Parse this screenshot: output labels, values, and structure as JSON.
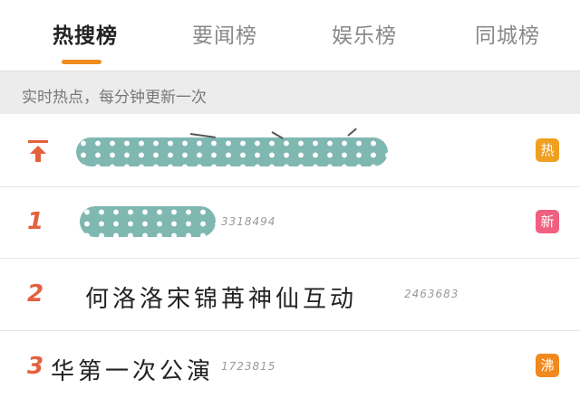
{
  "tabs": [
    {
      "label": "热搜榜",
      "active": true
    },
    {
      "label": "要闻榜",
      "active": false
    },
    {
      "label": "娱乐榜",
      "active": false
    },
    {
      "label": "同城榜",
      "active": false
    }
  ],
  "subheader": "实时热点，每分钟更新一次",
  "rows": [
    {
      "rank": "",
      "icon": "pin-top-icon",
      "title": "",
      "count": "",
      "badge": "热",
      "badge_color": "#f0a020"
    },
    {
      "rank": "1",
      "title": "",
      "count": "3318494",
      "badge": "新",
      "badge_color": "#f06080"
    },
    {
      "rank": "2",
      "title": "何洛洛宋锦苒神仙互动",
      "count": "2463683",
      "badge": "",
      "badge_color": ""
    },
    {
      "rank": "3",
      "title": "华第一次公演",
      "count": "1723815",
      "badge": "沸",
      "badge_color": "#f08a1e"
    }
  ],
  "colors": {
    "accent": "#f08c1e",
    "rank": "#e5603e",
    "blur": "#7fb7b1"
  }
}
